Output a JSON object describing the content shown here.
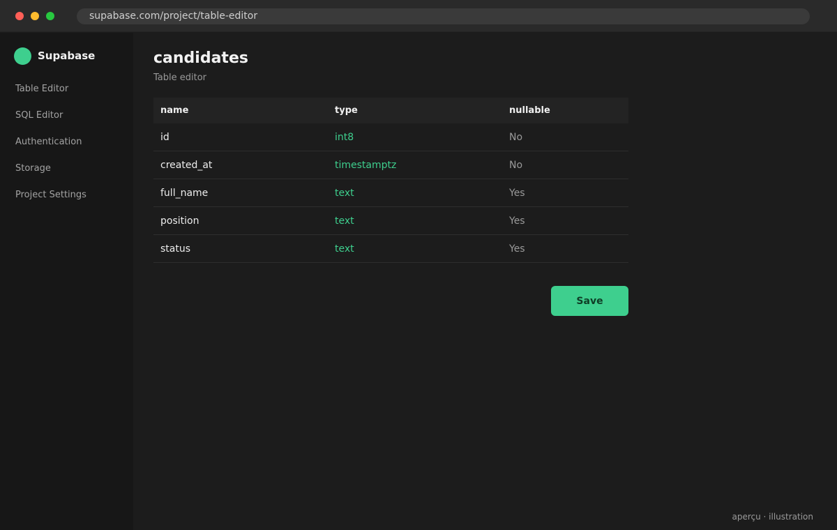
{
  "browser": {
    "url": "supabase.com/project/table-editor"
  },
  "sidebar": {
    "brand": "Supabase",
    "items": [
      {
        "label": "Table Editor"
      },
      {
        "label": "SQL Editor"
      },
      {
        "label": "Authentication"
      },
      {
        "label": "Storage"
      },
      {
        "label": "Project Settings"
      }
    ]
  },
  "main": {
    "title": "candidates",
    "subtitle": "Table editor",
    "table": {
      "headers": [
        "name",
        "type",
        "nullable"
      ],
      "rows": [
        {
          "name": "id",
          "type": "int8",
          "nullable": "No"
        },
        {
          "name": "created_at",
          "type": "timestamptz",
          "nullable": "No"
        },
        {
          "name": "full_name",
          "type": "text",
          "nullable": "Yes"
        },
        {
          "name": "position",
          "type": "text",
          "nullable": "Yes"
        },
        {
          "name": "status",
          "type": "text",
          "nullable": "Yes"
        }
      ]
    },
    "save_label": "Save"
  },
  "footer": {
    "note": "aperçu · illustration"
  },
  "colors": {
    "accent": "#3ecf8e",
    "background": "#1c1c1c",
    "sidebar": "#171717"
  }
}
